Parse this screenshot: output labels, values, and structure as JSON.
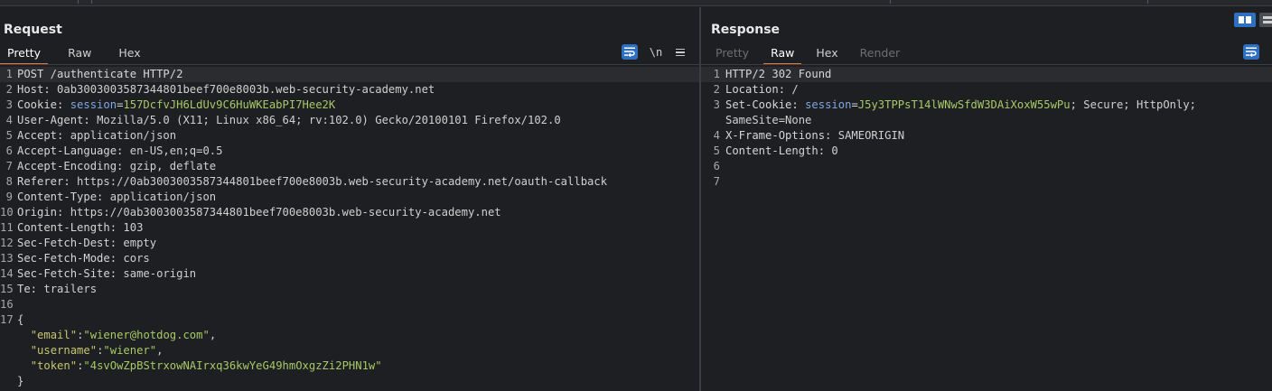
{
  "request": {
    "title": "Request",
    "tabs": [
      {
        "label": "Pretty",
        "state": "active"
      },
      {
        "label": "Raw",
        "state": "normal"
      },
      {
        "label": "Hex",
        "state": "normal"
      }
    ],
    "newline_toggle": "\\n",
    "lines": [
      {
        "n": "1",
        "parts": [
          {
            "t": "POST /authenticate HTTP/2",
            "c": "k"
          }
        ]
      },
      {
        "n": "2",
        "parts": [
          {
            "t": "Host: ",
            "c": "k"
          },
          {
            "t": "0ab3003003587344801beef700e8003b.web-security-academy.net",
            "c": "js"
          }
        ]
      },
      {
        "n": "3",
        "parts": [
          {
            "t": "Cookie: ",
            "c": "k"
          },
          {
            "t": "session",
            "c": "ck"
          },
          {
            "t": "=",
            "c": "k"
          },
          {
            "t": "157DcfvJH6LdUv9C6HuWKEabPI7Hee2K",
            "c": "cv"
          }
        ]
      },
      {
        "n": "4",
        "parts": [
          {
            "t": "User-Agent: ",
            "c": "k"
          },
          {
            "t": "Mozilla/5.0 (X11; Linux x86_64; rv:102.0) Gecko/20100101 Firefox/102.0",
            "c": "js"
          }
        ]
      },
      {
        "n": "5",
        "parts": [
          {
            "t": "Accept: ",
            "c": "k"
          },
          {
            "t": "application/json",
            "c": "js"
          }
        ]
      },
      {
        "n": "6",
        "parts": [
          {
            "t": "Accept-Language: ",
            "c": "k"
          },
          {
            "t": "en-US,en;q=0.5",
            "c": "js"
          }
        ]
      },
      {
        "n": "7",
        "parts": [
          {
            "t": "Accept-Encoding: ",
            "c": "k"
          },
          {
            "t": "gzip, deflate",
            "c": "js"
          }
        ]
      },
      {
        "n": "8",
        "parts": [
          {
            "t": "Referer: ",
            "c": "k"
          },
          {
            "t": "https://0ab3003003587344801beef700e8003b.web-security-academy.net/oauth-callback",
            "c": "js"
          }
        ]
      },
      {
        "n": "9",
        "parts": [
          {
            "t": "Content-Type: ",
            "c": "k"
          },
          {
            "t": "application/json",
            "c": "js"
          }
        ]
      },
      {
        "n": "10",
        "parts": [
          {
            "t": "Origin: ",
            "c": "k"
          },
          {
            "t": "https://0ab3003003587344801beef700e8003b.web-security-academy.net",
            "c": "js"
          }
        ]
      },
      {
        "n": "11",
        "parts": [
          {
            "t": "Content-Length: ",
            "c": "k"
          },
          {
            "t": "103",
            "c": "js"
          }
        ]
      },
      {
        "n": "12",
        "parts": [
          {
            "t": "Sec-Fetch-Dest: ",
            "c": "k"
          },
          {
            "t": "empty",
            "c": "js"
          }
        ]
      },
      {
        "n": "13",
        "parts": [
          {
            "t": "Sec-Fetch-Mode: ",
            "c": "k"
          },
          {
            "t": "cors",
            "c": "js"
          }
        ]
      },
      {
        "n": "14",
        "parts": [
          {
            "t": "Sec-Fetch-Site: ",
            "c": "k"
          },
          {
            "t": "same-origin",
            "c": "js"
          }
        ]
      },
      {
        "n": "15",
        "parts": [
          {
            "t": "Te: ",
            "c": "k"
          },
          {
            "t": "trailers",
            "c": "js"
          }
        ]
      },
      {
        "n": "16",
        "parts": []
      },
      {
        "n": "17",
        "parts": [
          {
            "t": "{",
            "c": "js"
          }
        ]
      },
      {
        "n": "",
        "parts": [
          {
            "t": "  ",
            "c": "js"
          },
          {
            "t": "\"email\"",
            "c": "jk"
          },
          {
            "t": ":",
            "c": "js"
          },
          {
            "t": "\"wiener@hotdog.com\"",
            "c": "jv"
          },
          {
            "t": ",",
            "c": "js"
          }
        ]
      },
      {
        "n": "",
        "parts": [
          {
            "t": "  ",
            "c": "js"
          },
          {
            "t": "\"username\"",
            "c": "jk"
          },
          {
            "t": ":",
            "c": "js"
          },
          {
            "t": "\"wiener\"",
            "c": "jv"
          },
          {
            "t": ",",
            "c": "js"
          }
        ]
      },
      {
        "n": "",
        "parts": [
          {
            "t": "  ",
            "c": "js"
          },
          {
            "t": "\"token\"",
            "c": "jk"
          },
          {
            "t": ":",
            "c": "js"
          },
          {
            "t": "\"4svOwZpBStrxowNAIrxq36kwYeG49hmOxgzZi2PHN1w\"",
            "c": "jv"
          }
        ]
      },
      {
        "n": "",
        "parts": [
          {
            "t": "}",
            "c": "js"
          }
        ]
      }
    ]
  },
  "response": {
    "title": "Response",
    "tabs": [
      {
        "label": "Pretty",
        "state": "disabled"
      },
      {
        "label": "Raw",
        "state": "active"
      },
      {
        "label": "Hex",
        "state": "normal"
      },
      {
        "label": "Render",
        "state": "disabled"
      }
    ],
    "lines": [
      {
        "n": "1",
        "parts": [
          {
            "t": "HTTP/2 302 Found",
            "c": "k"
          }
        ]
      },
      {
        "n": "2",
        "parts": [
          {
            "t": "Location: ",
            "c": "k"
          },
          {
            "t": "/",
            "c": "js"
          }
        ]
      },
      {
        "n": "3",
        "parts": [
          {
            "t": "Set-Cookie: ",
            "c": "k"
          },
          {
            "t": "session",
            "c": "ck"
          },
          {
            "t": "=",
            "c": "k"
          },
          {
            "t": "J5y3TPPsT14lWNwSfdW3DAiXoxW55wPu",
            "c": "cv"
          },
          {
            "t": "; Secure; HttpOnly;",
            "c": "js"
          }
        ]
      },
      {
        "n": "",
        "parts": [
          {
            "t": "SameSite=None",
            "c": "js"
          }
        ]
      },
      {
        "n": "4",
        "parts": [
          {
            "t": "X-Frame-Options: ",
            "c": "k"
          },
          {
            "t": "SAMEORIGIN",
            "c": "js"
          }
        ]
      },
      {
        "n": "5",
        "parts": [
          {
            "t": "Content-Length: ",
            "c": "k"
          },
          {
            "t": "0",
            "c": "js"
          }
        ]
      },
      {
        "n": "6",
        "parts": []
      },
      {
        "n": "7",
        "parts": []
      }
    ]
  },
  "colors": {
    "accent_tab": "#e8783a",
    "button_blue": "#2e6fc0",
    "background": "#1e1f22",
    "cookie_name": "#7fa7e0",
    "cookie_value": "#a7c965",
    "json_key": "#c7c66d"
  },
  "icons": {
    "wrap": "word-wrap-icon",
    "menu": "hamburger-menu-icon",
    "layout_split": "split-layout-icon",
    "layout_stacked": "stacked-layout-icon"
  }
}
